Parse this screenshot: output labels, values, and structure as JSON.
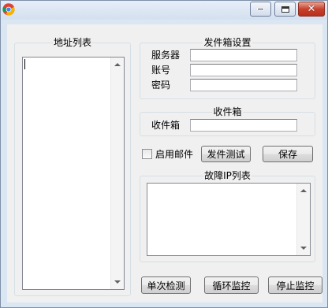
{
  "window": {
    "app_icon": "chrome-logo-icon",
    "controls": {
      "minimize": "minimize-icon",
      "maximize": "maximize-icon",
      "close": "✕"
    }
  },
  "address_list": {
    "title": "地址列表",
    "items": []
  },
  "sender_settings": {
    "title": "发件箱设置",
    "server_label": "服务器",
    "server_value": "",
    "account_label": "账号",
    "account_value": "",
    "password_label": "密码",
    "password_value": ""
  },
  "inbox": {
    "title": "收件箱",
    "inbox_label": "收件箱",
    "inbox_value": ""
  },
  "options": {
    "enable_mail_label": "启用邮件",
    "enable_mail_checked": false
  },
  "buttons": {
    "send_test": "发件测试",
    "save": "保存",
    "single_check": "单次检测",
    "loop_monitor": "循环监控",
    "stop_monitor": "停止监控"
  },
  "fault_ip": {
    "title": "故障IP列表",
    "items": []
  }
}
